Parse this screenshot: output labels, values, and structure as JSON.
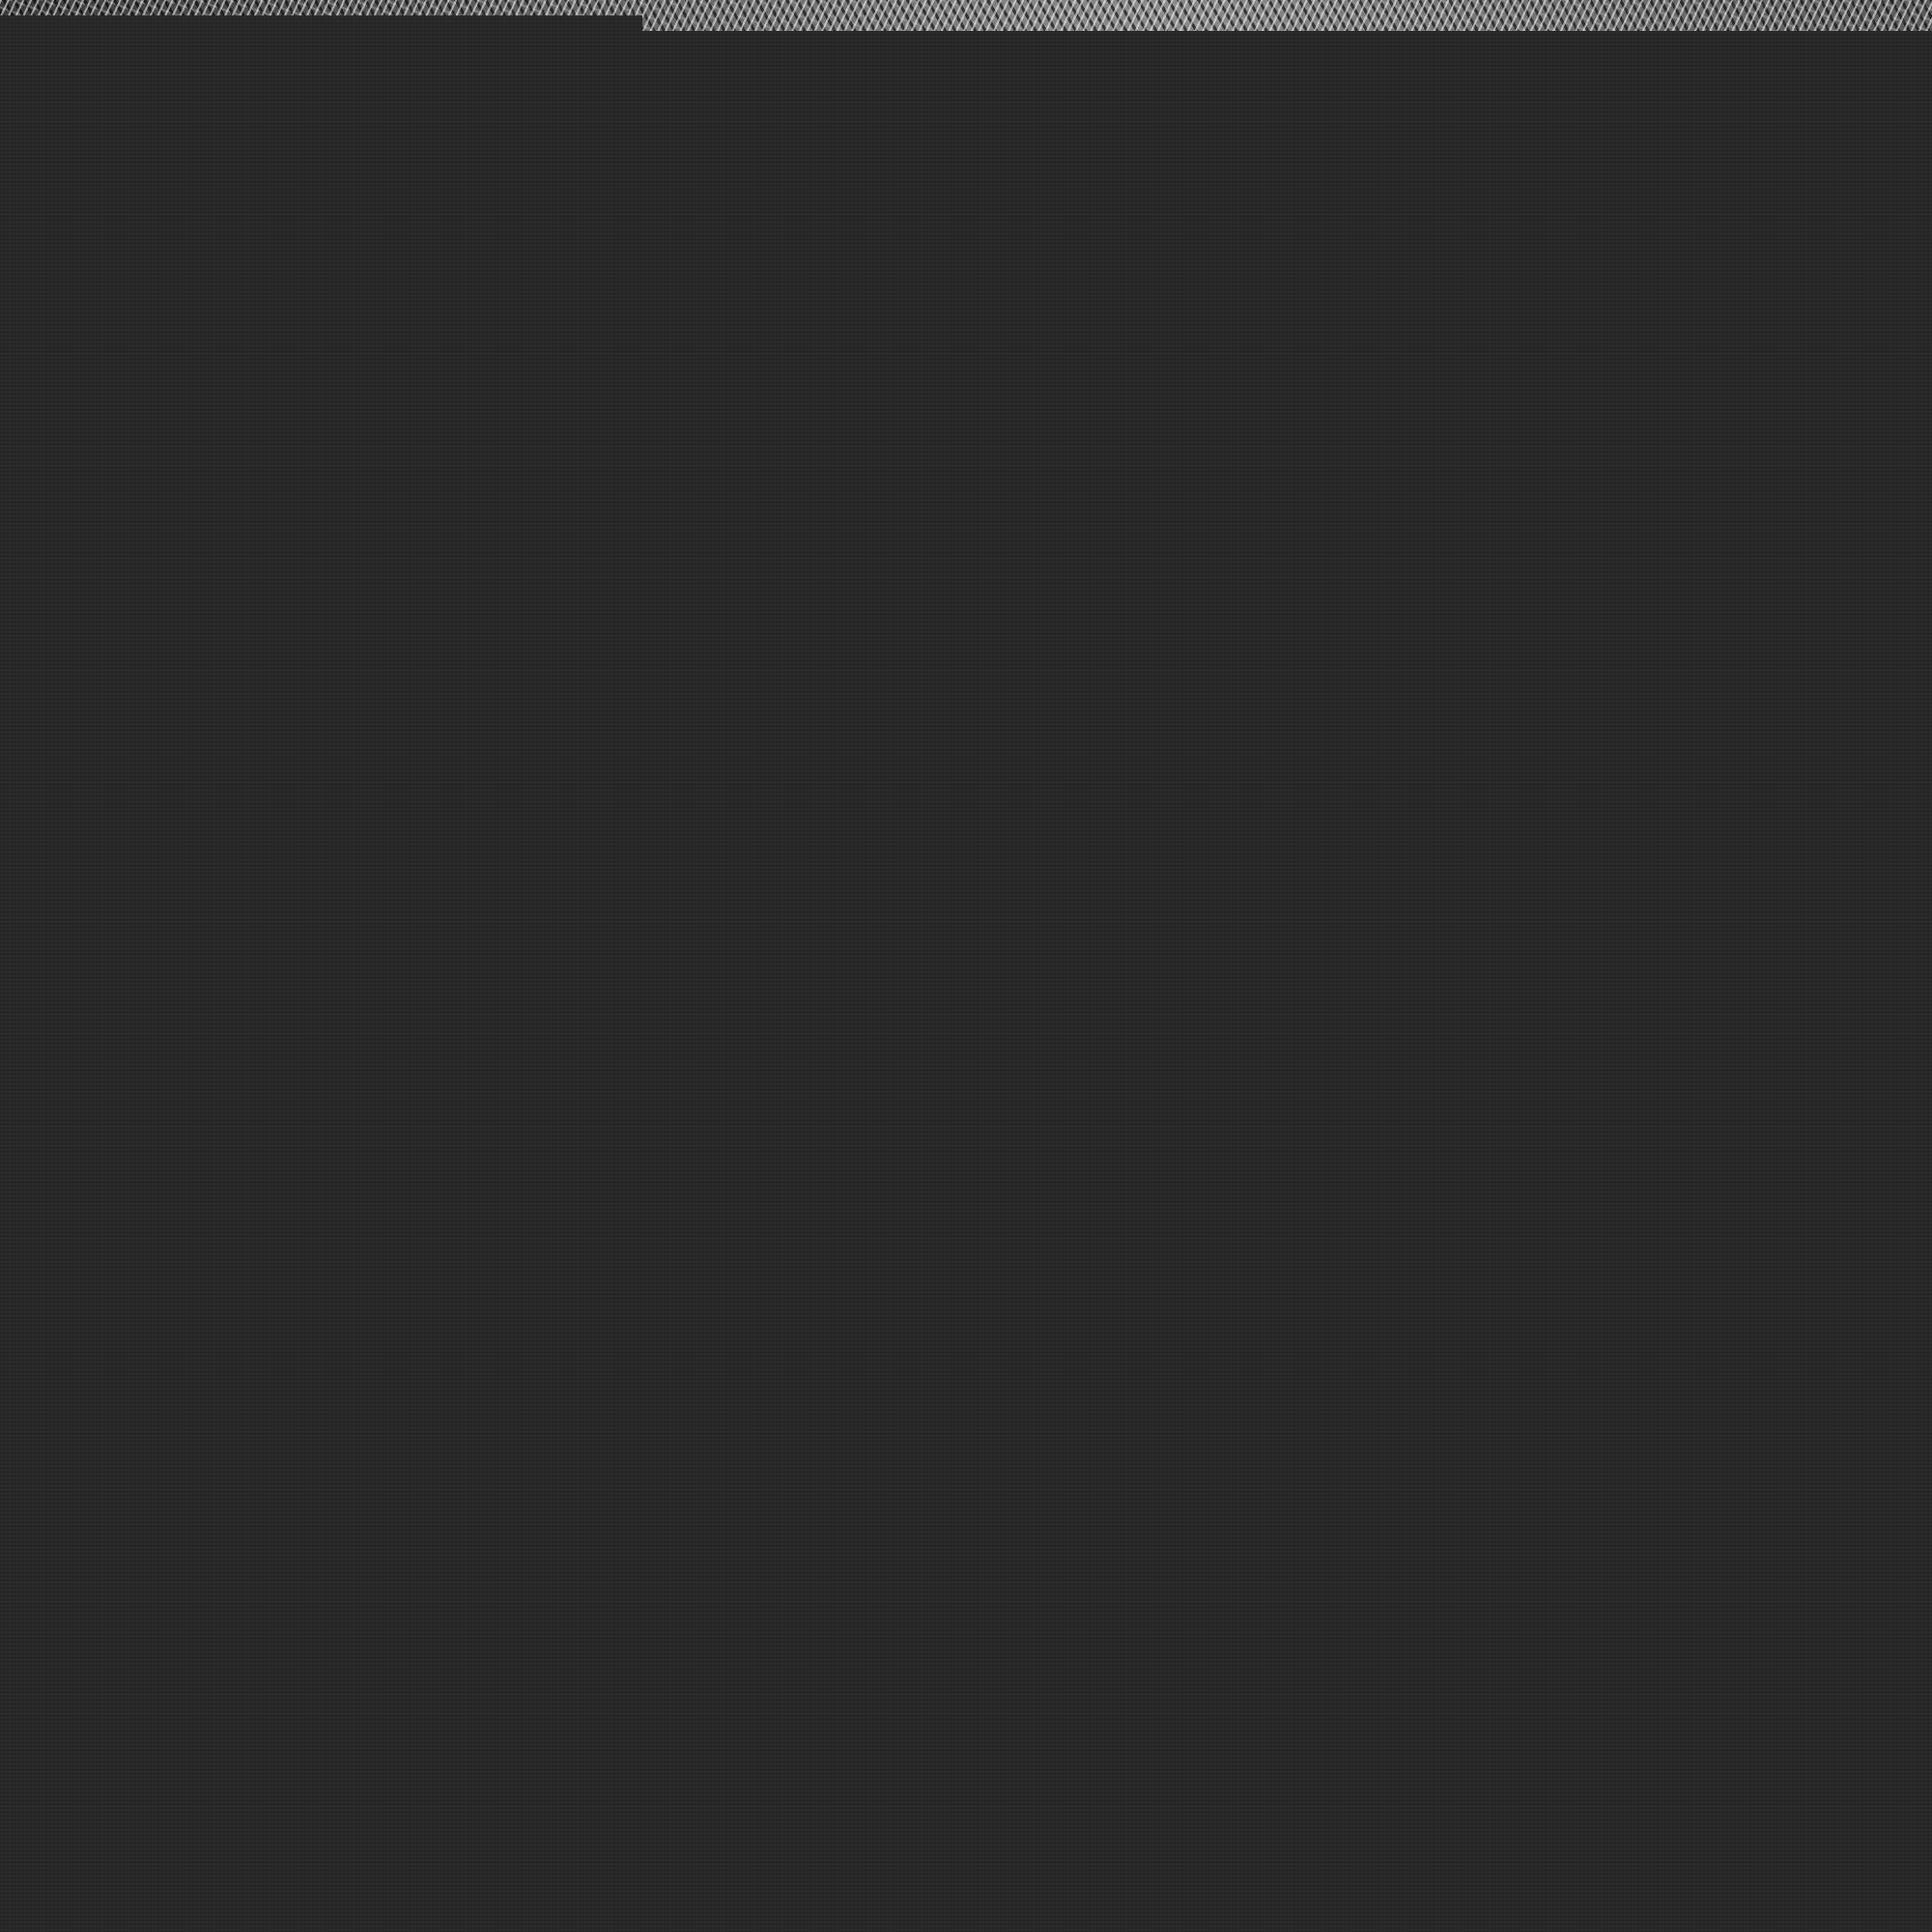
{
  "page": {
    "background_color": "#262626",
    "overlay_color": "#262626",
    "top_strip": "textured-image"
  }
}
